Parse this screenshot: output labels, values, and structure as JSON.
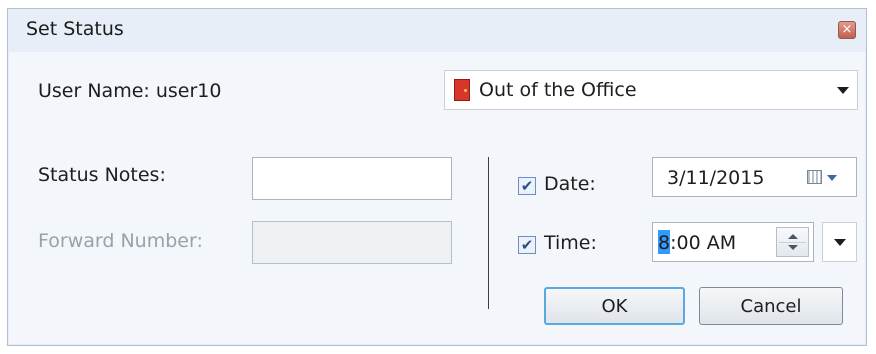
{
  "window": {
    "title": "Set Status",
    "close_glyph": "×"
  },
  "user": {
    "label": "User Name: user10"
  },
  "status": {
    "selected": "Out of the Office",
    "icon": "door-icon",
    "icon_color": "#d8362b"
  },
  "notes": {
    "label": "Status Notes:",
    "value": ""
  },
  "forward": {
    "label": "Forward Number:",
    "value": "",
    "enabled": false
  },
  "date": {
    "checked": true,
    "check_glyph": "✔",
    "label": "Date:",
    "value": "3/11/2015"
  },
  "time": {
    "checked": true,
    "check_glyph": "✔",
    "label": "Time:",
    "value": "8:00 AM",
    "selected_part": "8",
    "selection_color": "#3399ff"
  },
  "buttons": {
    "ok": "OK",
    "cancel": "Cancel"
  }
}
